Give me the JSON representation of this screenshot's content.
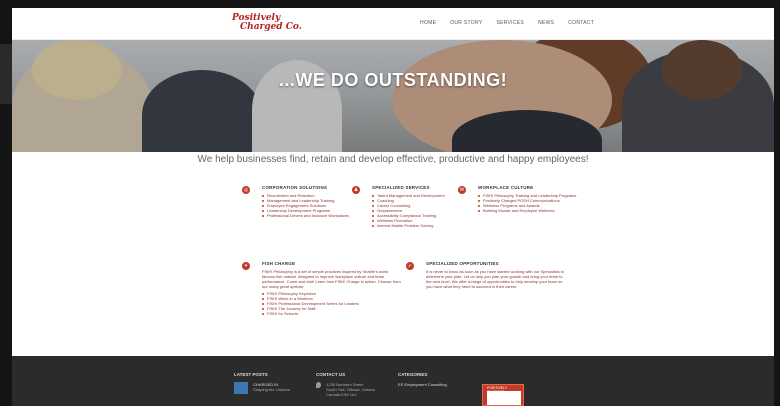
{
  "logo": {
    "line1": "Positively",
    "line2": "Charged Co."
  },
  "nav": [
    "HOME",
    "OUR STORY",
    "SERVICES",
    "NEWS",
    "CONTACT"
  ],
  "hero": {
    "title": "...WE DO OUTSTANDING!"
  },
  "tagline": "We help businesses find, retain and develop effective, productive and happy employees!",
  "services": [
    {
      "icon": "target-icon",
      "title": "CORPORATION SOLUTIONS",
      "items": [
        "Recruitment and Retention",
        "Management and Leadership Training",
        "Employee Engagement Solutions",
        "Leadership Development Programs",
        "Professional Drivers and Inclusive Workplaces"
      ]
    },
    {
      "icon": "person-icon",
      "title": "SPECIALIZED SERVICES",
      "items": [
        "Talent Management and Development",
        "Coaching",
        "Career Counseling",
        "Outplacement",
        "Accessibility Compliance Training",
        "Wellness Promotion",
        "Internal Mobile Problem Solving"
      ]
    },
    {
      "icon": "mail-icon",
      "title": "WORKPLACE CULTURE",
      "items": [
        "FISH! Philosophy Training and Leadership Programs",
        "Positively Charged POSH Communications",
        "Wellness Programs and Awards",
        "Building Morale and Employee Wellness"
      ]
    },
    {
      "icon": "fish-icon",
      "title": "FISH CHARGE",
      "text": "FISH! Philosophy is a set of simple practices inspired by Seattle's world famous fish market, designed to improve workplace culture and team performance. Come and visit! Learn how FISH! Charge in action. Choose from our many great options:",
      "items": [
        "FISH! Philosophy Keynotes",
        "FISH! Week in a Workbox",
        "FISH! Professional Development Series for Leaders",
        "FISH! The Journey for Staff",
        "FISH! for Schools"
      ]
    },
    {
      "icon": "rocket-icon",
      "title": "SPECIALIZED OPPORTUNITIES",
      "text": "It is never to know as soon as you have started working with our Specialists to determine your plan. Let us help you plan your growth and bring your team to the next level. We offer a range of opportunities to help develop your team so you have what they need to succeed in their career."
    }
  ],
  "footer": {
    "latest_posts": {
      "title": "LATEST POSTS",
      "post_title": "CHARGED IN",
      "post_sub": "Shaping the Leaders"
    },
    "contact": {
      "title": "CONTACT US",
      "line1": "1235 Northern Street",
      "line2": "South Tsie, Ottawa, Ontario",
      "line3": "Canada K9A 1A1"
    },
    "categories": {
      "title": "CATEGORIES",
      "item": "ES Employment Consulting"
    },
    "badge": "POSITIVELY CHARGED"
  }
}
